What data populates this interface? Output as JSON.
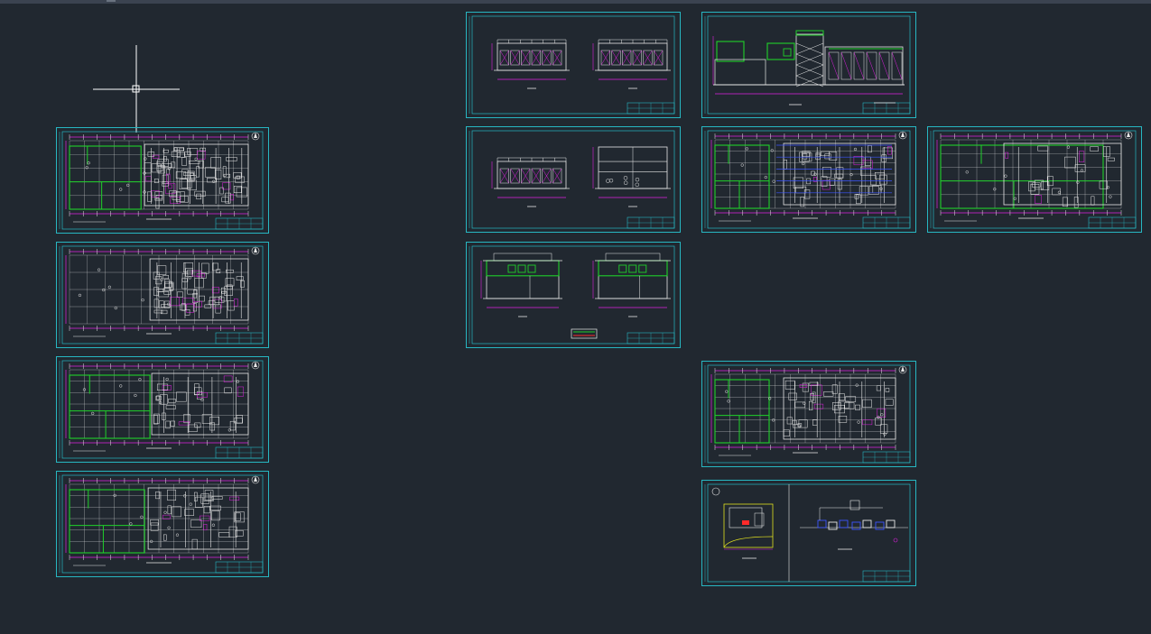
{
  "app": {
    "background": "#212830",
    "frame_color": "#27b7c2"
  },
  "palette": {
    "white": "#e8e8e8",
    "magenta": "#e020e0",
    "green": "#1fd12a",
    "cyan": "#28c4d0",
    "blue": "#3c55ff",
    "red": "#ff2a2a",
    "yellow": "#e0e020",
    "gray": "#8a8a8a"
  },
  "cursor": {
    "icon": "crosshair-cursor-icon"
  },
  "sheets": [
    {
      "id": "plan-1",
      "kind": "plan-a"
    },
    {
      "id": "plan-2",
      "kind": "plan-b"
    },
    {
      "id": "plan-3",
      "kind": "plan-c"
    },
    {
      "id": "plan-4",
      "kind": "plan-d"
    },
    {
      "id": "elev-1",
      "kind": "elev-a"
    },
    {
      "id": "elev-2",
      "kind": "elev-b"
    },
    {
      "id": "elev-3",
      "kind": "elev-c"
    },
    {
      "id": "elev-wide",
      "kind": "elev-wide"
    },
    {
      "id": "plan-5",
      "kind": "plan-e"
    },
    {
      "id": "plan-6",
      "kind": "plan-f"
    },
    {
      "id": "plan-7",
      "kind": "plan-g"
    },
    {
      "id": "site-detail",
      "kind": "site"
    }
  ]
}
